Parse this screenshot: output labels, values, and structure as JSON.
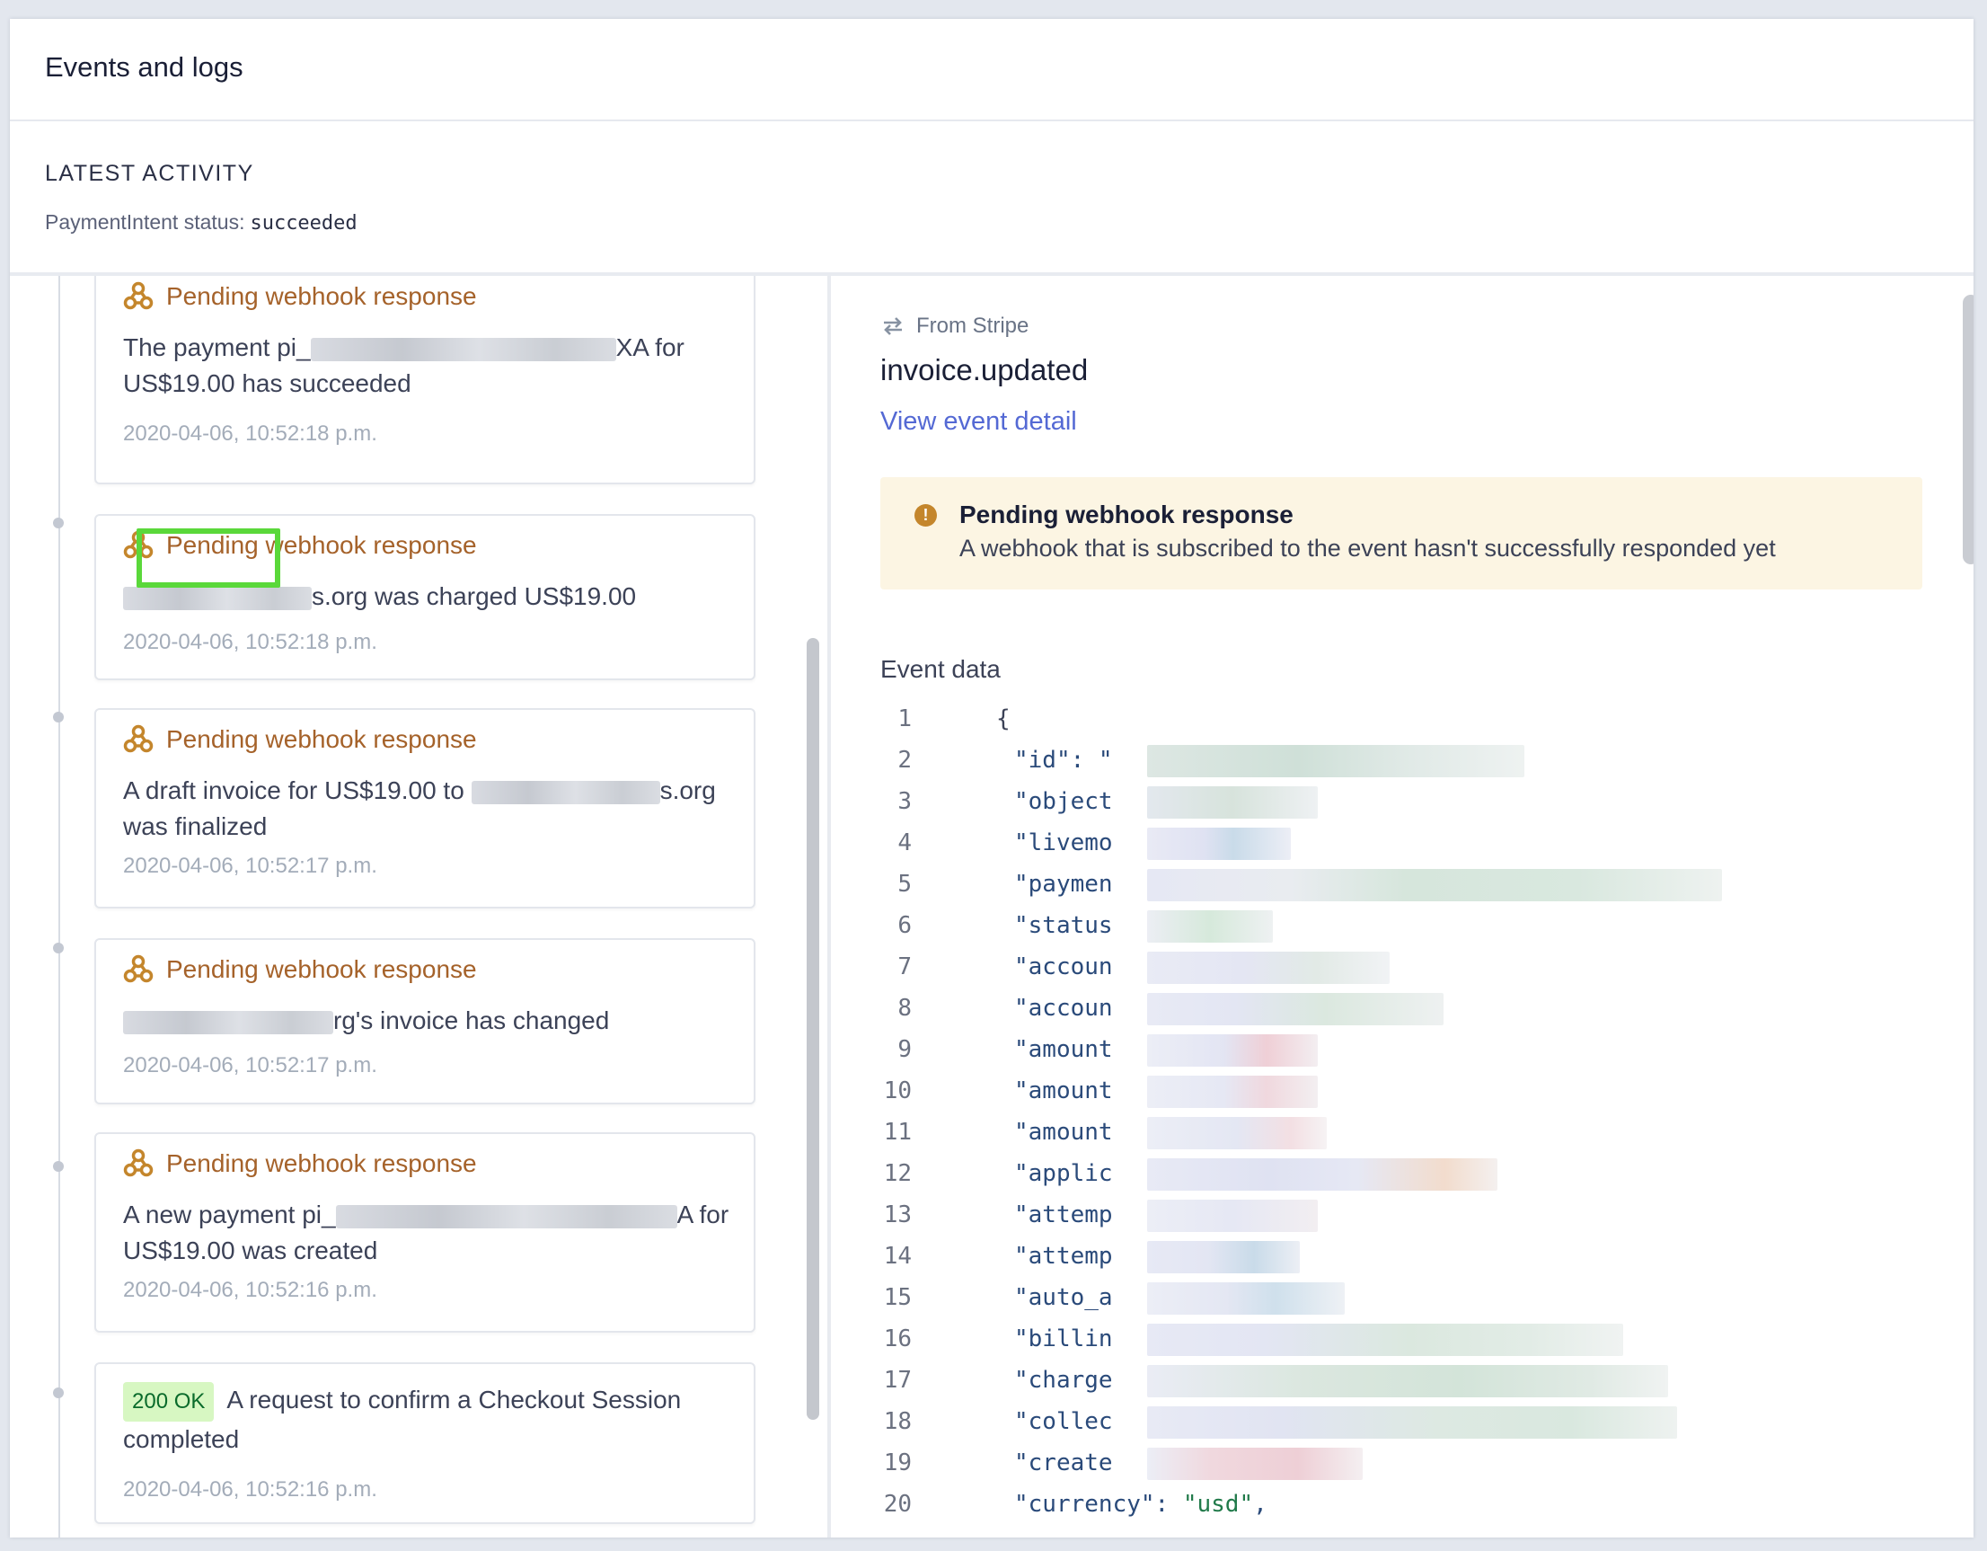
{
  "header": {
    "title": "Events and logs"
  },
  "latest": {
    "heading": "LATEST ACTIVITY",
    "status_label": "PaymentIntent status:",
    "status_value": "succeeded"
  },
  "events": [
    {
      "label": "Pending webhook response",
      "text_before": "The payment pi_",
      "text_after": "XA for US$19.00 has succeeded",
      "timestamp": "2020-04-06, 10:52:18 p.m."
    },
    {
      "label": "Pending webhook response",
      "text_before": "",
      "text_after": "s.org was charged US$19.00",
      "timestamp": "2020-04-06, 10:52:18 p.m."
    },
    {
      "label": "Pending webhook response",
      "text_before": "A draft invoice for US$19.00 to",
      "text_after": "s.org was finalized",
      "timestamp": "2020-04-06, 10:52:17 p.m."
    },
    {
      "label": "Pending webhook response",
      "text_before": "",
      "text_after": "rg's invoice has changed",
      "timestamp": "2020-04-06, 10:52:17 p.m."
    },
    {
      "label": "Pending webhook response",
      "text_before": "A new payment pi_",
      "text_after": "A for US$19.00 was created",
      "timestamp": "2020-04-06, 10:52:16 p.m."
    },
    {
      "badge": "200 OK",
      "text": "A request to confirm a Checkout Session completed",
      "timestamp": "2020-04-06, 10:52:16 p.m."
    }
  ],
  "detail": {
    "source": "From Stripe",
    "event_type": "invoice.updated",
    "view_link": "View event detail",
    "alert_title": "Pending webhook response",
    "alert_desc": "A webhook that is subscribed to the event hasn't successfully responded yet",
    "event_data_label": "Event data"
  },
  "code_lines": [
    {
      "n": "1",
      "text": "{"
    },
    {
      "n": "2",
      "text": "\"id\": \""
    },
    {
      "n": "3",
      "text": "\"object"
    },
    {
      "n": "4",
      "text": "\"livemo"
    },
    {
      "n": "5",
      "text": "\"paymen"
    },
    {
      "n": "6",
      "text": "\"status"
    },
    {
      "n": "7",
      "text": "\"accoun"
    },
    {
      "n": "8",
      "text": "\"accoun"
    },
    {
      "n": "9",
      "text": "\"amount"
    },
    {
      "n": "10",
      "text": "\"amount"
    },
    {
      "n": "11",
      "text": "\"amount"
    },
    {
      "n": "12",
      "text": "\"applic"
    },
    {
      "n": "13",
      "text": "\"attemp"
    },
    {
      "n": "14",
      "text": "\"attemp"
    },
    {
      "n": "15",
      "text": "\"auto_a"
    },
    {
      "n": "16",
      "text": "\"billin"
    },
    {
      "n": "17",
      "text": "\"charge"
    },
    {
      "n": "18",
      "text": "\"collec"
    },
    {
      "n": "19",
      "text": "\"create"
    },
    {
      "n": "20",
      "key": "\"currency\": ",
      "value": "\"usd\"",
      "suffix": ","
    }
  ],
  "colors": {
    "webhook_label": "#a5622a",
    "link": "#5469d4",
    "alert_bg": "#fcf5e3",
    "ok_badge_bg": "#d7f7c2",
    "ok_badge_text": "#0a6b2b",
    "highlight_box": "#5ad83a"
  }
}
